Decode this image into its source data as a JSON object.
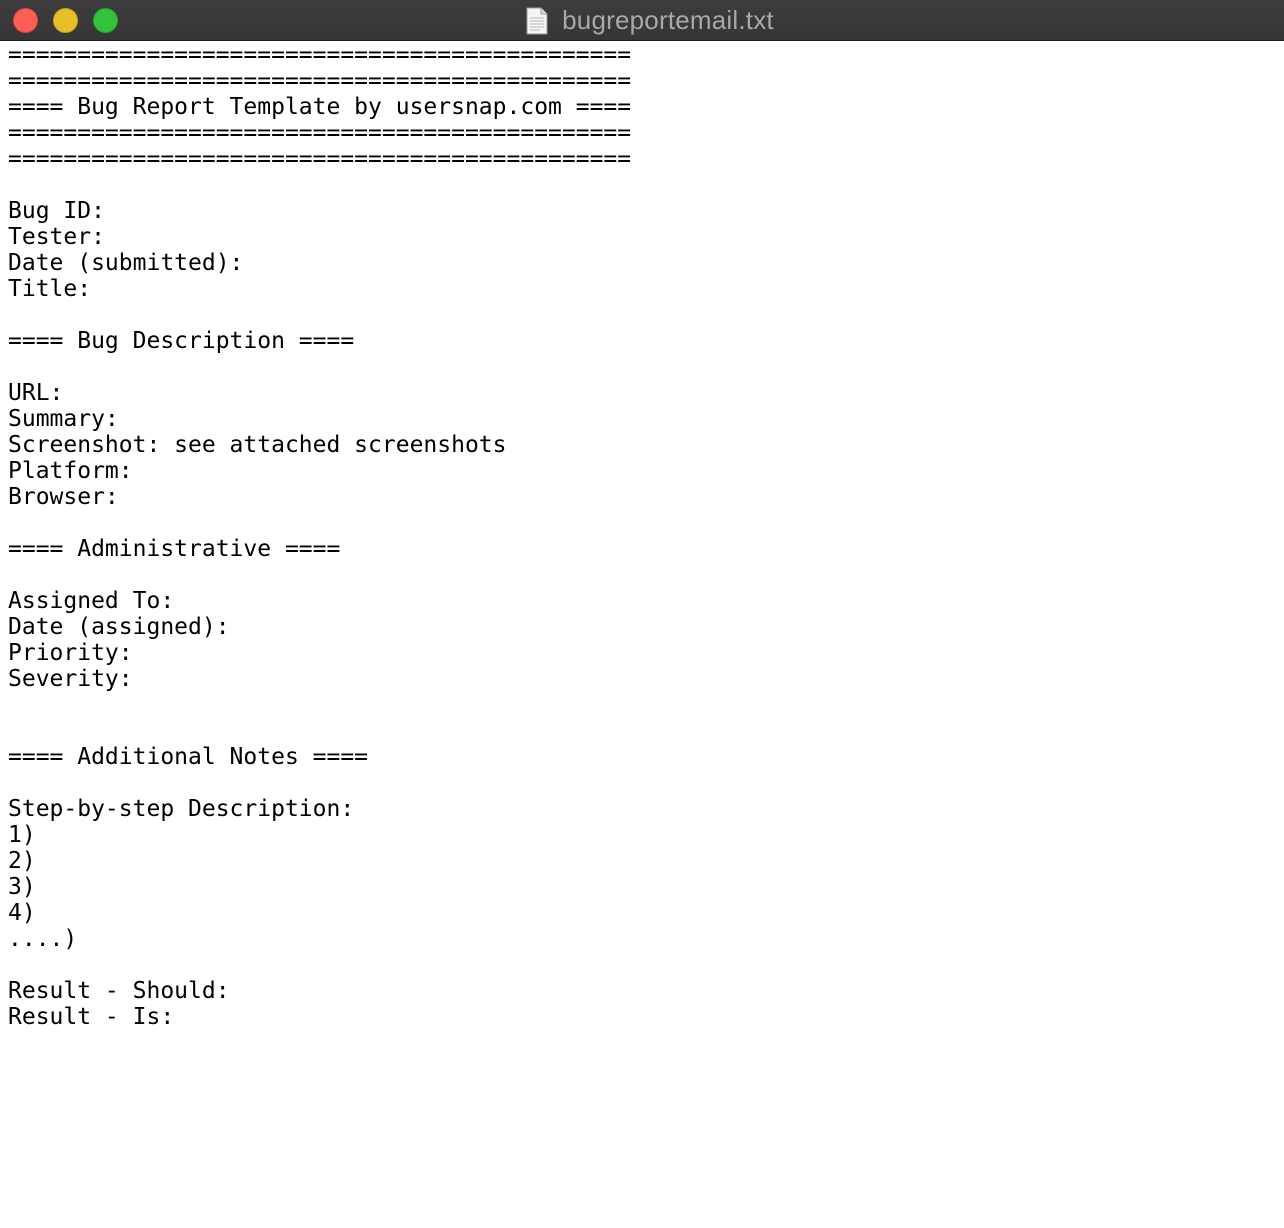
{
  "window": {
    "title": "bugreportemail.txt",
    "icon": "text-document-icon"
  },
  "document": {
    "lines": [
      "=============================================",
      "=============================================",
      "==== Bug Report Template by usersnap.com ====",
      "=============================================",
      "=============================================",
      "",
      "Bug ID:",
      "Tester:",
      "Date (submitted):",
      "Title:",
      "",
      "==== Bug Description ====",
      "",
      "URL:",
      "Summary:",
      "Screenshot: see attached screenshots",
      "Platform:",
      "Browser:",
      "",
      "==== Administrative ====",
      "",
      "Assigned To:",
      "Date (assigned):",
      "Priority:",
      "Severity:",
      "",
      "",
      "==== Additional Notes ====",
      "",
      "Step-by-step Description:",
      "1)",
      "2)",
      "3)",
      "4)",
      "....)",
      "",
      "Result - Should:",
      "Result - Is:"
    ],
    "caret_line": 11
  }
}
